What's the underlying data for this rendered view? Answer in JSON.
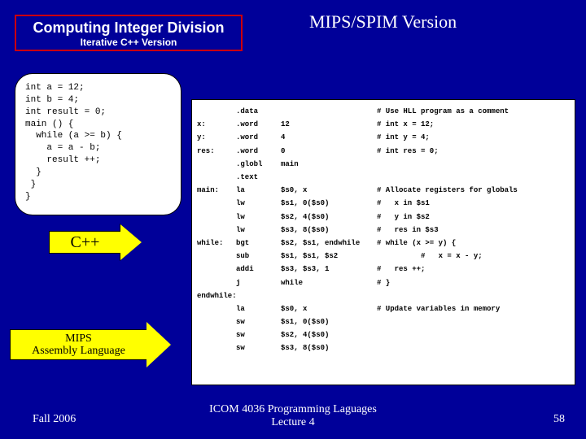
{
  "title": {
    "main": "Computing Integer Division",
    "sub": "Iterative C++ Version"
  },
  "version_label": "MIPS/SPIM Version",
  "cpp_code": "int a = 12;\nint b = 4;\nint result = 0;\nmain () {\n  while (a >= b) {\n    a = a - b;\n    result ++;\n  }\n }\n}",
  "asm": [
    {
      "label": "",
      "dir": ".data",
      "arg": "",
      "com": "# Use HLL program as a comment"
    },
    {
      "label": "x:",
      "dir": ".word",
      "arg": "12",
      "com": "# int x = 12;"
    },
    {
      "label": "y:",
      "dir": ".word",
      "arg": "4",
      "com": "# int y = 4;"
    },
    {
      "label": "res:",
      "dir": ".word",
      "arg": "0",
      "com": "# int res = 0;"
    },
    {
      "label": "",
      "dir": ".globl",
      "arg": "main",
      "com": ""
    },
    {
      "label": "",
      "dir": ".text",
      "arg": "",
      "com": ""
    },
    {
      "label": "main:",
      "dir": "la",
      "arg": "$s0, x",
      "com": "# Allocate registers for globals"
    },
    {
      "label": "",
      "dir": "lw",
      "arg": "$s1, 0($s0)",
      "com": "#   x in $s1"
    },
    {
      "label": "",
      "dir": "lw",
      "arg": "$s2, 4($s0)",
      "com": "#   y in $s2"
    },
    {
      "label": "",
      "dir": "lw",
      "arg": "$s3, 8($s0)",
      "com": "#   res in $s3"
    },
    {
      "label": "while:",
      "dir": "bgt",
      "arg": "$s2, $s1, endwhile",
      "com": "# while (x >= y) {"
    },
    {
      "label": "",
      "dir": "sub",
      "arg": "$s1, $s1, $s2",
      "com": "          #   x = x - y;"
    },
    {
      "label": "",
      "dir": "addi",
      "arg": "$s3, $s3, 1",
      "com": "#   res ++;"
    },
    {
      "label": "",
      "dir": "j",
      "arg": "while",
      "com": "# }"
    },
    {
      "label": "endwhile:",
      "dir": "",
      "arg": "",
      "com": ""
    },
    {
      "label": "",
      "dir": "la",
      "arg": "$s0, x",
      "com": "# Update variables in memory"
    },
    {
      "label": "",
      "dir": "sw",
      "arg": "$s1, 0($s0)",
      "com": ""
    },
    {
      "label": "",
      "dir": "sw",
      "arg": "$s2, 4($s0)",
      "com": ""
    },
    {
      "label": "",
      "dir": "sw",
      "arg": "$s3, 8($s0)",
      "com": ""
    }
  ],
  "arrows": {
    "cpp": "C++",
    "mips_l1": "MIPS",
    "mips_l2": "Assembly Language"
  },
  "footer": {
    "left": "Fall 2006",
    "center_l1": "ICOM 4036 Programming Laguages",
    "center_l2": "Lecture 4",
    "right": "58"
  }
}
